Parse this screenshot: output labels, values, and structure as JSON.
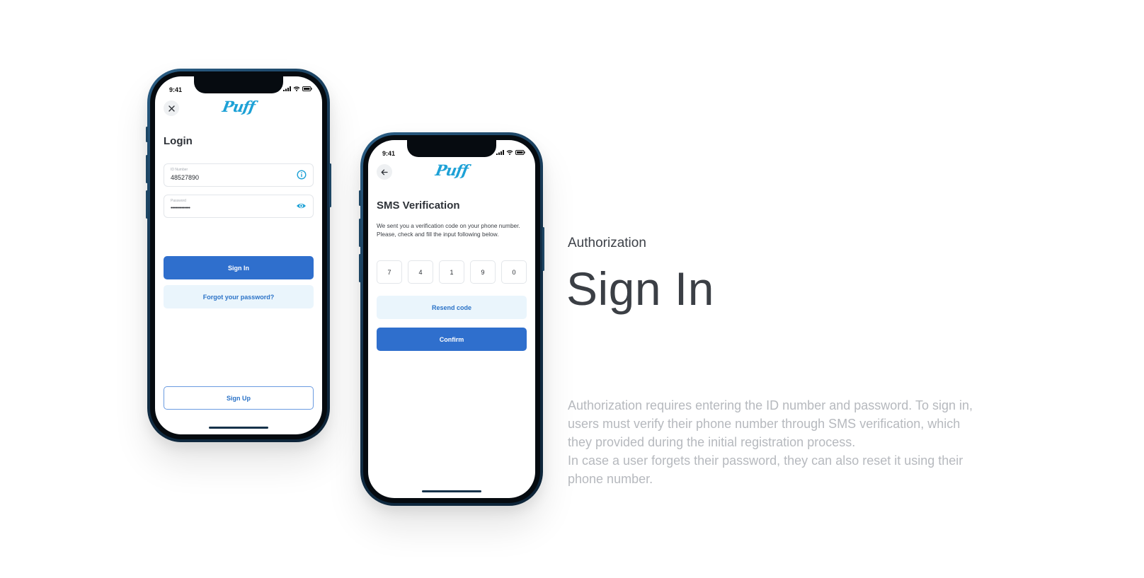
{
  "colors": {
    "primary": "#2f6fcd",
    "soft": "#eaf5fc",
    "brand": "#1da1d6",
    "frame": "#123049"
  },
  "login_screen": {
    "status_time": "9:41",
    "close_icon": "close-icon",
    "logo": "Puff",
    "title": "Login",
    "id_field": {
      "label": "ID Number",
      "value": "48527890",
      "icon": "info-icon"
    },
    "password_field": {
      "label": "Password",
      "value": "••••••••••••••",
      "icon": "eye-icon"
    },
    "sign_in_label": "Sign In",
    "forgot_label": "Forgot your password?",
    "sign_up_label": "Sign Up"
  },
  "sms_screen": {
    "status_time": "9:41",
    "back_icon": "arrow-left-icon",
    "logo": "Puff",
    "title": "SMS Verification",
    "description_line1": "We sent you a verification code on your phone number.",
    "description_line2": "Please, check and fill the input following below.",
    "code_digits": [
      "7",
      "4",
      "1",
      "9",
      "0"
    ],
    "resend_label": "Resend code",
    "confirm_label": "Confirm"
  },
  "copy": {
    "kicker": "Authorization",
    "title": "Sign In",
    "paragraph1": "Authorization requires entering the ID number and password. To sign in, users must verify their phone number through SMS verification, which they provided during the initial registration process.",
    "paragraph2": "In case a user forgets their password, they can also reset it using their phone number."
  }
}
